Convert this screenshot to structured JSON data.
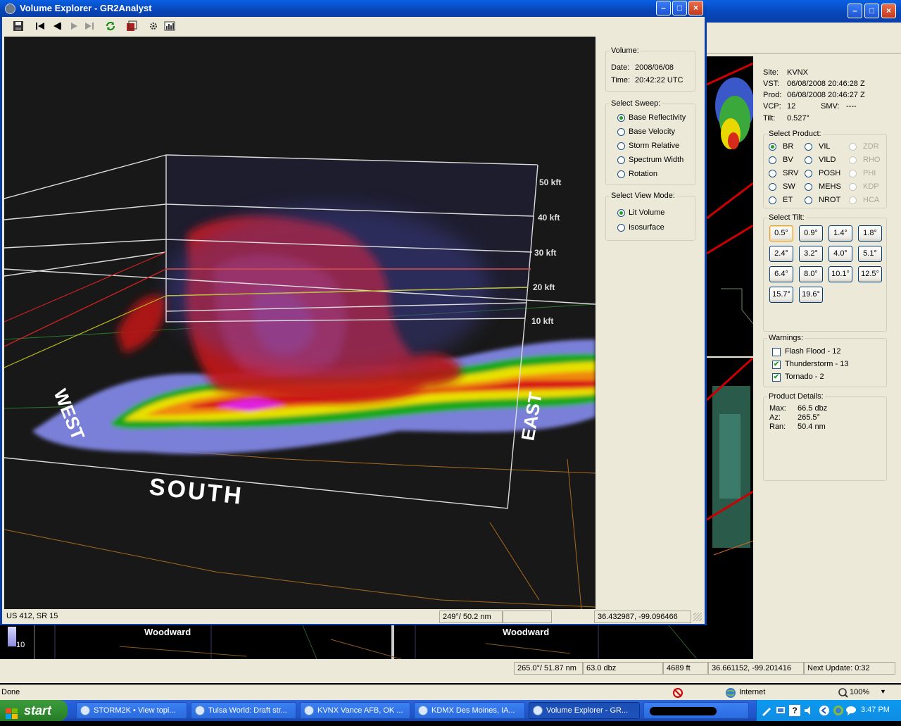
{
  "colors": {
    "xp_blue": "#0a5fe3",
    "reflectivity_red": "#d01818",
    "panel_bg": "#ece9d8"
  },
  "volume_explorer": {
    "title": "Volume Explorer - GR2Analyst",
    "toolbar_icons": [
      "save-icon",
      "first-frame-icon",
      "previous-frame-icon",
      "play-icon",
      "last-frame-icon",
      "refresh-icon",
      "export-icon",
      "settings-icon",
      "histogram-icon"
    ],
    "volume": {
      "legend": "Volume:",
      "date_label": "Date:",
      "date": "2008/06/08",
      "time_label": "Time:",
      "time": "20:42:22 UTC"
    },
    "sweep": {
      "legend": "Select Sweep:",
      "options": [
        "Base Reflectivity",
        "Base Velocity",
        "Storm Relative",
        "Spectrum Width",
        "Rotation"
      ],
      "selected": "Base Reflectivity"
    },
    "view_mode": {
      "legend": "Select View Mode:",
      "options": [
        "Lit Volume",
        "Isosurface"
      ],
      "selected": "Lit Volume"
    },
    "scene": {
      "heights": [
        "50 kft",
        "40 kft",
        "30 kft",
        "20 kft",
        "10 kft"
      ],
      "dir_south": "SOUTH",
      "dir_west": "WEST",
      "dir_east": "EAST"
    },
    "status": {
      "road": "US 412, SR 15",
      "azimuth_range": "249°/ 50.2 nm",
      "latlon": "36.432987, -99.096466"
    }
  },
  "main_window": {
    "site_info": {
      "site_label": "Site:",
      "site": "KVNX",
      "vst_label": "VST:",
      "vst": "06/08/2008  20:46:28 Z",
      "prod_label": "Prod:",
      "prod": "06/08/2008  20:46:27 Z",
      "vcp_label": "VCP:",
      "vcp": "12",
      "smv_label": "SMV:",
      "smv": "----",
      "tilt_label": "Tilt:",
      "tilt": "0.527°"
    },
    "product": {
      "legend": "Select Product:",
      "col1": [
        "BR",
        "BV",
        "SRV",
        "SW",
        "ET"
      ],
      "col2": [
        "VIL",
        "VILD",
        "POSH",
        "MEHS",
        "NROT"
      ],
      "col3": [
        "ZDR",
        "RHO",
        "PHI",
        "KDP",
        "HCA"
      ],
      "selected": "BR"
    },
    "tilt": {
      "legend": "Select Tilt:",
      "values": [
        "0.5°",
        "0.9°",
        "1.4°",
        "1.8°",
        "2.4°",
        "3.2°",
        "4.0°",
        "5.1°",
        "6.4°",
        "8.0°",
        "10.1°",
        "12.5°",
        "15.7°",
        "19.6°"
      ],
      "selected": "0.5°"
    },
    "warnings": {
      "legend": "Warnings:",
      "items": [
        {
          "label": "Flash Flood - 12",
          "checked": false
        },
        {
          "label": "Thunderstorm - 13",
          "checked": true
        },
        {
          "label": "Tornado - 2",
          "checked": true
        }
      ]
    },
    "details": {
      "legend": "Product Details:",
      "max_label": "Max:",
      "max": "66.5 dbz",
      "az_label": "Az:",
      "az": "265.5°",
      "ran_label": "Ran:",
      "ran": "50.4 nm"
    },
    "map_labels": {
      "left": "Woodward",
      "right": "Woodward",
      "scale": "10"
    },
    "status": {
      "azimuth_range": "265.0°/ 51.87 nm",
      "value": "63.0 dbz",
      "height": "4689 ft",
      "latlon": "36.661152, -99.201416",
      "next_update": "Next Update: 0:32"
    }
  },
  "browser_status": {
    "text": "Done",
    "zone": "Internet",
    "zoom": "100%"
  },
  "taskbar": {
    "start": "start",
    "items": [
      "STORM2K • View topi...",
      "Tulsa World: Draft str...",
      "KVNX Vance AFB, OK ...",
      "KDMX Des Moines, IA...",
      "Volume Explorer - GR..."
    ],
    "active": "Volume Explorer - GR...",
    "clock": "3:47 PM"
  }
}
